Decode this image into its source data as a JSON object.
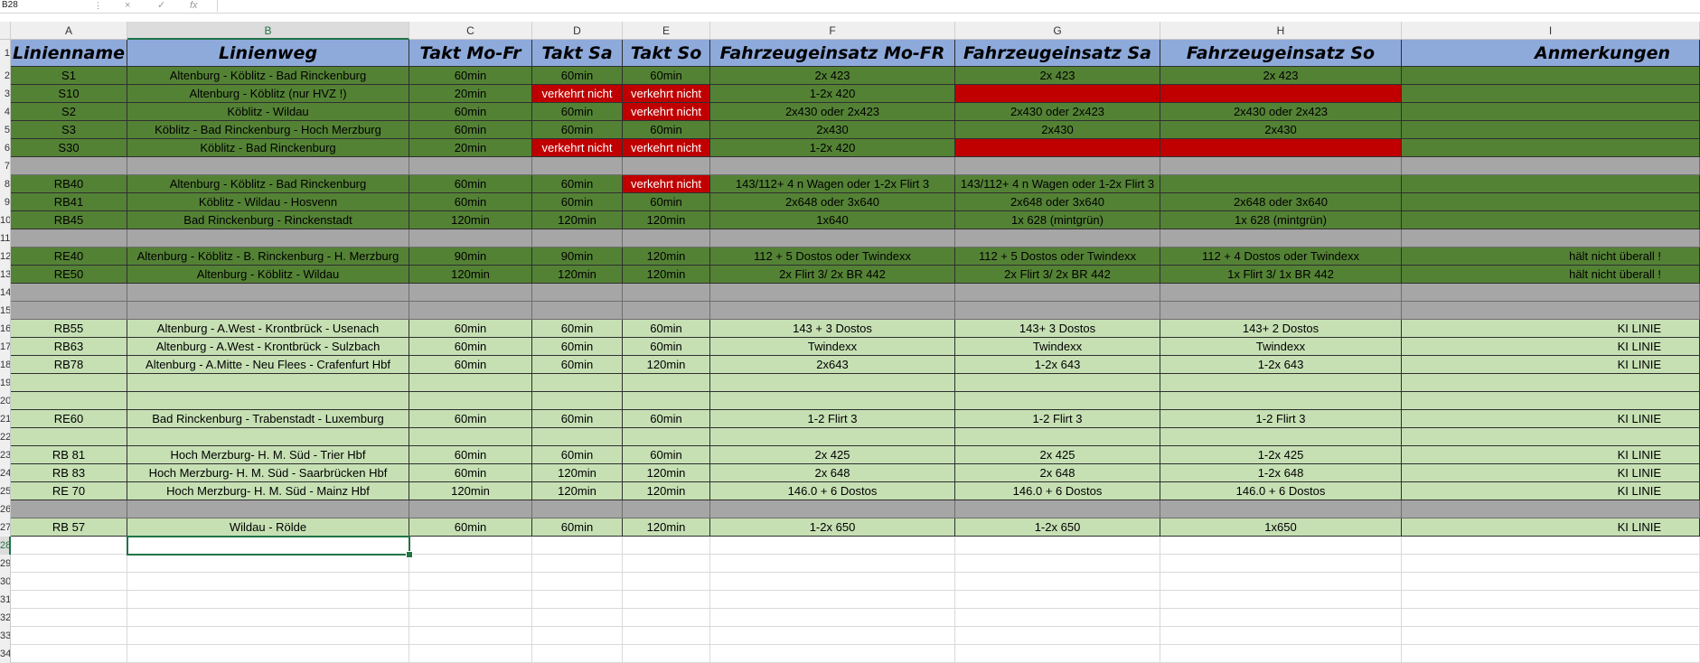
{
  "formula_bar": {
    "name_box": "B28",
    "cancel_icon": "×",
    "enter_icon": "✓",
    "fx_label": "fx",
    "formula": ""
  },
  "colors": {
    "header": "#8eaadb",
    "dark_green": "#548235",
    "light_green": "#c6e0b4",
    "gray": "#a6a6a6",
    "red": "#c00000",
    "white": "#ffffff",
    "selection": "#217346"
  },
  "columns": [
    "A",
    "B",
    "C",
    "D",
    "E",
    "F",
    "G",
    "H",
    "I"
  ],
  "selected": {
    "column": "B",
    "row": "28",
    "row_index": 27
  },
  "rows": [
    {
      "num": "1",
      "style": "head",
      "cells": [
        "Linienname",
        "Linienweg",
        "Takt Mo-Fr",
        "Takt Sa",
        "Takt So",
        "Fahrzeugeinsatz Mo-FR",
        "Fahrzeugeinsatz Sa",
        "Fahrzeugeinsatz So",
        "Anmerkungen"
      ]
    },
    {
      "num": "2",
      "style": "dark",
      "cells": [
        "S1",
        "Altenburg - Köblitz - Bad Rinckenburg",
        "60min",
        "60min",
        "60min",
        "2x 423",
        "2x 423",
        "2x 423",
        ""
      ]
    },
    {
      "num": "3",
      "style": "dark",
      "red": [
        3,
        4,
        6,
        7
      ],
      "cells": [
        "S10",
        "Altenburg - Köblitz (nur HVZ !)",
        "20min",
        "verkehrt nicht",
        "verkehrt nicht",
        "1-2x 420",
        "",
        "",
        ""
      ]
    },
    {
      "num": "4",
      "style": "dark",
      "red": [
        4
      ],
      "cells": [
        "S2",
        "Köblitz - Wildau",
        "60min",
        "60min",
        "verkehrt nicht",
        "2x430 oder 2x423",
        "2x430 oder 2x423",
        "2x430 oder 2x423",
        ""
      ]
    },
    {
      "num": "5",
      "style": "dark",
      "cells": [
        "S3",
        "Köblitz  - Bad Rinckenburg - Hoch Merzburg",
        "60min",
        "60min",
        "60min",
        "2x430",
        "2x430",
        "2x430",
        ""
      ]
    },
    {
      "num": "6",
      "style": "dark",
      "red": [
        3,
        4,
        6,
        7
      ],
      "cells": [
        "S30",
        "Köblitz - Bad Rinckenburg",
        "20min",
        "verkehrt nicht",
        "verkehrt nicht",
        "1-2x 420",
        "",
        "",
        ""
      ]
    },
    {
      "num": "7",
      "style": "gray",
      "cells": [
        "",
        "",
        "",
        "",
        "",
        "",
        "",
        "",
        ""
      ]
    },
    {
      "num": "8",
      "style": "dark",
      "red": [
        4
      ],
      "cells": [
        "RB40",
        "Altenburg - Köblitz - Bad Rinckenburg",
        "60min",
        "60min",
        "verkehrt nicht",
        "143/112+ 4 n Wagen oder 1-2x Flirt 3",
        "143/112+ 4 n Wagen oder 1-2x Flirt 3",
        "",
        ""
      ]
    },
    {
      "num": "9",
      "style": "dark",
      "cells": [
        "RB41",
        "Köblitz - Wildau - Hosvenn",
        "60min",
        "60min",
        "60min",
        "2x648 oder 3x640",
        "2x648 oder 3x640",
        "2x648 oder 3x640",
        ""
      ]
    },
    {
      "num": "10",
      "style": "dark",
      "cells": [
        "RB45",
        "Bad Rinckenburg - Rinckenstadt",
        "120min",
        "120min",
        "120min",
        "1x640",
        "1x 628 (mintgrün)",
        "1x 628 (mintgrün)",
        ""
      ]
    },
    {
      "num": "11",
      "style": "gray",
      "cells": [
        "",
        "",
        "",
        "",
        "",
        "",
        "",
        "",
        ""
      ]
    },
    {
      "num": "12",
      "style": "dark",
      "cells": [
        "RE40",
        "Altenburg - Köblitz - B. Rinckenburg - H. Merzburg",
        "90min",
        "90min",
        "120min",
        "112 + 5 Dostos oder Twindexx",
        "112 + 5 Dostos oder Twindexx",
        "112 + 4 Dostos oder Twindexx",
        "hält nicht überall !"
      ]
    },
    {
      "num": "13",
      "style": "dark",
      "cells": [
        "RE50",
        "Altenburg - Köblitz - Wildau",
        "120min",
        "120min",
        "120min",
        "2x Flirt 3/ 2x BR 442",
        "2x Flirt 3/ 2x BR 442",
        "1x Flirt 3/ 1x BR 442",
        "hält nicht überall !"
      ]
    },
    {
      "num": "14",
      "style": "gray",
      "cells": [
        "",
        "",
        "",
        "",
        "",
        "",
        "",
        "",
        ""
      ]
    },
    {
      "num": "15",
      "style": "gray",
      "cells": [
        "",
        "",
        "",
        "",
        "",
        "",
        "",
        "",
        ""
      ]
    },
    {
      "num": "16",
      "style": "light",
      "cells": [
        "RB55",
        "Altenburg - A.West - Krontbrück - Usenach",
        "60min",
        "60min",
        "60min",
        "143 + 3 Dostos",
        "143+ 3 Dostos",
        "143+ 2 Dostos",
        "KI LINIE"
      ]
    },
    {
      "num": "17",
      "style": "light",
      "cells": [
        "RB63",
        "Altenburg - A.West - Krontbrück - Sulzbach",
        "60min",
        "60min",
        "60min",
        "Twindexx",
        "Twindexx",
        "Twindexx",
        "KI LINIE"
      ]
    },
    {
      "num": "18",
      "style": "light",
      "cells": [
        "RB78",
        "Altenburg - A.Mitte - Neu Flees - Crafenfurt Hbf",
        "60min",
        "60min",
        "120min",
        "2x643",
        "1-2x 643",
        "1-2x 643",
        "KI LINIE"
      ]
    },
    {
      "num": "19",
      "style": "light",
      "cells": [
        "",
        "",
        "",
        "",
        "",
        "",
        "",
        "",
        ""
      ]
    },
    {
      "num": "20",
      "style": "light",
      "cells": [
        "",
        "",
        "",
        "",
        "",
        "",
        "",
        "",
        ""
      ]
    },
    {
      "num": "21",
      "style": "light",
      "cells": [
        "RE60",
        "Bad Rinckenburg - Trabenstadt - Luxemburg",
        "60min",
        "60min",
        "60min",
        "1-2 Flirt 3",
        "1-2 Flirt 3",
        "1-2 Flirt 3",
        "KI LINIE"
      ]
    },
    {
      "num": "22",
      "style": "light",
      "cells": [
        "",
        "",
        "",
        "",
        "",
        "",
        "",
        "",
        ""
      ]
    },
    {
      "num": "23",
      "style": "light",
      "cells": [
        "RB 81",
        "Hoch Merzburg- H. M. Süd - Trier  Hbf",
        "60min",
        "60min",
        "60min",
        "2x 425",
        "2x 425",
        "1-2x 425",
        "KI LINIE"
      ]
    },
    {
      "num": "24",
      "style": "light",
      "cells": [
        "RB 83",
        "Hoch Merzburg- H. M. Süd - Saarbrücken  Hbf",
        "60min",
        "120min",
        "120min",
        "2x 648",
        "2x 648",
        "1-2x 648",
        "KI LINIE"
      ]
    },
    {
      "num": "25",
      "style": "light",
      "cells": [
        "RE 70",
        "Hoch Merzburg- H. M. Süd - Mainz Hbf",
        "120min",
        "120min",
        "120min",
        "146.0 + 6 Dostos",
        "146.0 + 6 Dostos",
        "146.0 + 6 Dostos",
        "KI LINIE"
      ]
    },
    {
      "num": "26",
      "style": "gray",
      "cells": [
        "",
        "",
        "",
        "",
        "",
        "",
        "",
        "",
        ""
      ]
    },
    {
      "num": "27",
      "style": "light",
      "cells": [
        "RB 57",
        "Wildau - Rölde",
        "60min",
        "60min",
        "120min",
        "1-2x 650",
        "1-2x 650",
        "1x650",
        "KI LINIE"
      ]
    },
    {
      "num": "28",
      "style": "empty",
      "cells": [
        "",
        "",
        "",
        "",
        "",
        "",
        "",
        "",
        ""
      ]
    },
    {
      "num": "29",
      "style": "empty",
      "cells": [
        "",
        "",
        "",
        "",
        "",
        "",
        "",
        "",
        ""
      ]
    },
    {
      "num": "30",
      "style": "empty",
      "cells": [
        "",
        "",
        "",
        "",
        "",
        "",
        "",
        "",
        ""
      ]
    },
    {
      "num": "31",
      "style": "empty",
      "cells": [
        "",
        "",
        "",
        "",
        "",
        "",
        "",
        "",
        ""
      ]
    },
    {
      "num": "32",
      "style": "empty",
      "cells": [
        "",
        "",
        "",
        "",
        "",
        "",
        "",
        "",
        ""
      ]
    },
    {
      "num": "33",
      "style": "empty",
      "cells": [
        "",
        "",
        "",
        "",
        "",
        "",
        "",
        "",
        ""
      ]
    },
    {
      "num": "34",
      "style": "empty",
      "cells": [
        "",
        "",
        "",
        "",
        "",
        "",
        "",
        "",
        ""
      ]
    }
  ]
}
